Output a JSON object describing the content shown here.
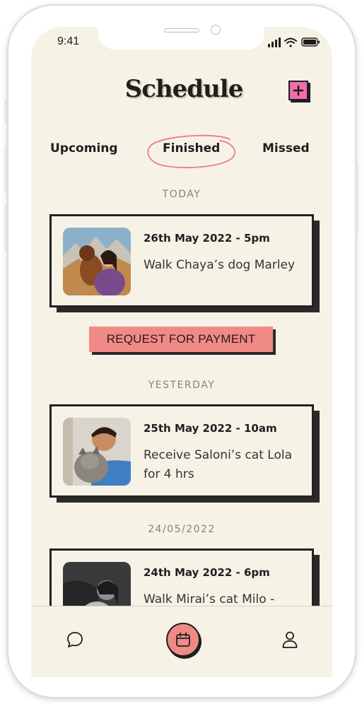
{
  "status_bar": {
    "time": "9:41"
  },
  "header": {
    "title": "Schedule",
    "add_icon": "plus-square-icon"
  },
  "tabs": [
    {
      "label": "Upcoming",
      "active": false
    },
    {
      "label": "Finished",
      "active": true
    },
    {
      "label": "Missed",
      "active": false
    }
  ],
  "sections": [
    {
      "heading": "TODAY",
      "items": [
        {
          "datetime": "26th May 2022 - 5pm",
          "description": "Walk Chaya’s dog Marley",
          "photo": "woman-with-dog-photo"
        }
      ],
      "action_label": "REQUEST FOR PAYMENT"
    },
    {
      "heading": "YESTERDAY",
      "items": [
        {
          "datetime": "25th May 2022 - 10am",
          "description": "Receive Saloni’s cat Lola for 4 hrs",
          "photo": "man-with-cat-photo"
        }
      ]
    },
    {
      "heading": "24/05/2022",
      "items": [
        {
          "datetime": "24th May 2022 - 6pm",
          "description": "Walk Mirai’s cat Milo -",
          "photo": "woman-with-cat-photo"
        }
      ]
    }
  ],
  "bottom_nav": [
    {
      "icon": "chat-icon",
      "active": false
    },
    {
      "icon": "calendar-icon",
      "active": true
    },
    {
      "icon": "profile-icon",
      "active": false
    }
  ],
  "colors": {
    "background": "#f7f2e6",
    "accent_pink": "#f06dab",
    "accent_coral": "#f08a86",
    "ink": "#1f1f1f"
  }
}
